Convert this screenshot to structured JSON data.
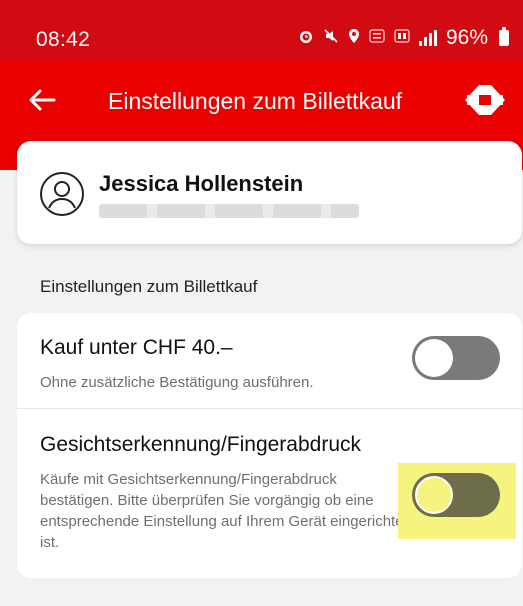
{
  "status_bar": {
    "time": "08:42",
    "battery": "96%",
    "icons": [
      "alarm-icon",
      "mute-icon",
      "location-icon",
      "volte-icon",
      "5g-icon",
      "signal-icon",
      "battery-icon"
    ]
  },
  "app_bar": {
    "title": "Einstellungen zum Billettkauf",
    "back_icon": "back-arrow-icon",
    "logo": "sbb-logo-icon",
    "background": "#eb0000"
  },
  "profile": {
    "name": "Jessica Hollenstein",
    "avatar_icon": "user-avatar-icon"
  },
  "section": {
    "heading": "Einstellungen zum Billettkauf"
  },
  "settings": [
    {
      "title": "Kauf unter CHF 40.–",
      "description": "Ohne zusätzliche Bestätigung ausführen.",
      "enabled": false
    },
    {
      "title": "Gesichtserkennung/Fingerabdruck",
      "description": "Käufe mit Gesichtserkennung/Fingerabdruck bestätigen. Bitte überprüfen Sie vorgängig ob eine entsprechende Einstellung auf Ihrem Gerät eingerichtet ist.",
      "enabled": false,
      "highlighted": true
    }
  ],
  "colors": {
    "accent_red": "#eb0000",
    "toggle_off": "#7a7a7a",
    "highlight": "#f6f47e"
  }
}
